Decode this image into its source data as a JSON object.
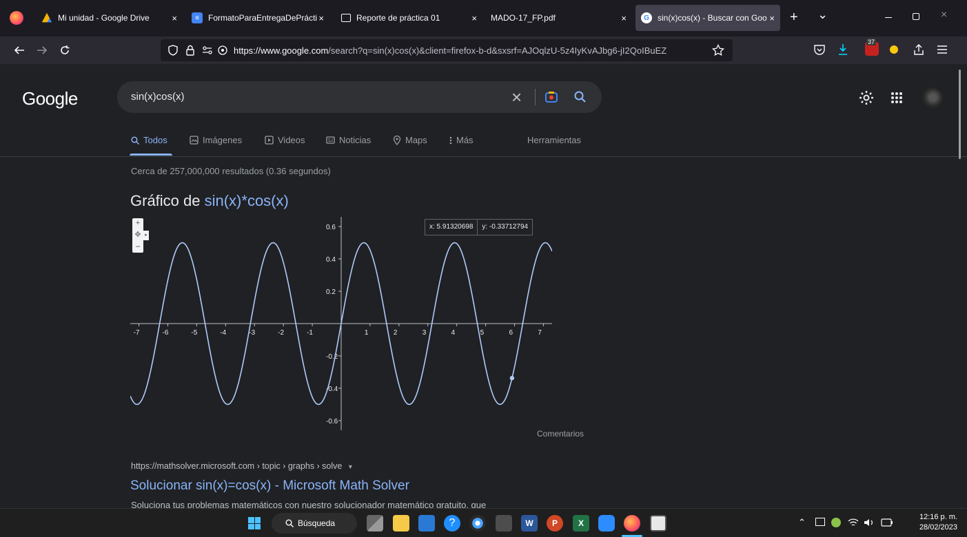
{
  "browser": {
    "tabs": [
      {
        "label": "Mi unidad - Google Drive",
        "icon": "google-drive-icon"
      },
      {
        "label": "FormatoParaEntregaDePráctic",
        "icon": "google-docs-icon"
      },
      {
        "label": "Reporte de práctica 01",
        "icon": "slides-icon"
      },
      {
        "label": "MADO-17_FP.pdf",
        "icon": "pdf-icon"
      },
      {
        "label": "sin(x)cos(x) - Buscar con Goo",
        "icon": "google-icon"
      }
    ],
    "close_glyph": "×",
    "new_tab_glyph": "+",
    "tab_list_glyph": "⌄",
    "url_host": "https://www.google.com",
    "url_path": "/search?q=sin(x)cos(x)&client=firefox-b-d&sxsrf=AJOqlzU-5z4IyKvAJbg6-jI2QoIBuEZ",
    "extension_badge": "37"
  },
  "google": {
    "logo": "Google",
    "query": "sin(x)cos(x)",
    "clear_glyph": "×",
    "tabs": [
      {
        "label": "Todos",
        "icon": "search-icon",
        "active": true
      },
      {
        "label": "Imágenes",
        "icon": "image-icon"
      },
      {
        "label": "Videos",
        "icon": "video-icon"
      },
      {
        "label": "Noticias",
        "icon": "news-icon"
      },
      {
        "label": "Maps",
        "icon": "map-pin-icon"
      },
      {
        "label": "Más",
        "icon": "more-icon"
      }
    ],
    "tools": "Herramientas",
    "result_stats": "Cerca de 257,000,000 resultados (0.36 segundos)",
    "graph_title_prefix": "Gráfico de ",
    "graph_title_func": "sin(x)*cos(x)",
    "feedback": "Comentarios",
    "tooltip_x": "x: 5.91320698",
    "tooltip_y": "y: -0.33712794",
    "result": {
      "url": "https://mathsolver.microsoft.com › topic › graphs › solve",
      "title": "Solucionar sin(x)=cos(x) - Microsoft Math Solver",
      "snippet": "Soluciona tus problemas matemáticos con nuestro solucionador matemático gratuito, que"
    }
  },
  "chart_data": {
    "type": "line",
    "function": "sin(x)*cos(x)",
    "xlim": [
      -7.3,
      7.3
    ],
    "ylim": [
      -0.66,
      0.66
    ],
    "x_ticks": [
      -7,
      -6,
      -5,
      -4,
      -3,
      -2,
      -1,
      1,
      2,
      3,
      4,
      5,
      6,
      7
    ],
    "y_ticks": [
      -0.6,
      -0.4,
      -0.2,
      0.2,
      0.4,
      0.6
    ],
    "x_tick_labels": [
      "-7",
      "-6",
      "-5",
      "-4",
      "-3",
      "-2",
      "-1",
      "1",
      "2",
      "3",
      "4",
      "5",
      "6",
      "7"
    ],
    "y_tick_labels": [
      "-0.6",
      "-0.4",
      "-0.2",
      "0.2",
      "0.4",
      "0.6"
    ],
    "highlight_point": {
      "x": 5.91320698,
      "y": -0.33712794
    },
    "colors": {
      "line": "#aecbfa",
      "axis": "#bdc1c6"
    },
    "grid": false
  },
  "taskbar": {
    "search_label": "Búsqueda",
    "time": "12:16 p. m.",
    "date": "28/02/2023"
  }
}
